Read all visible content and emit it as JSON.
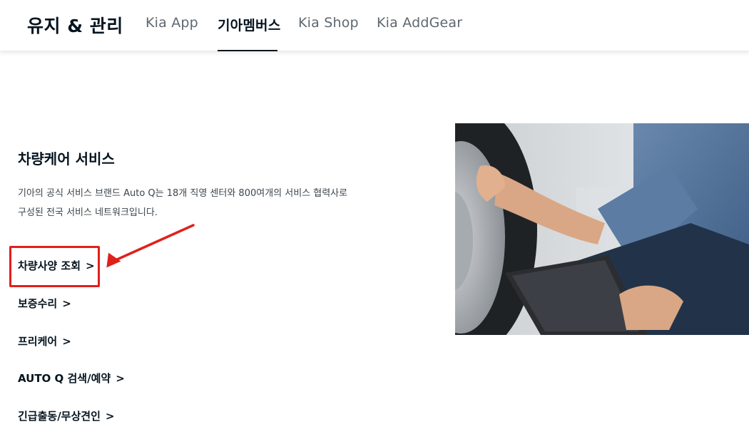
{
  "header": {
    "section_title": "유지 & 관리",
    "tabs": [
      {
        "label": "Kia App",
        "active": false
      },
      {
        "label": "기아멤버스",
        "active": true
      },
      {
        "label": "Kia Shop",
        "active": false
      },
      {
        "label": "Kia AddGear",
        "active": false
      }
    ]
  },
  "main": {
    "title": "차량케어 서비스",
    "description_lines": [
      "기아의 공식 서비스 브랜드 Auto Q는 18개 직영 센터와 800여개의 서비스 협력사로",
      "구성된 전국 서비스 네트워크입니다."
    ],
    "links": [
      {
        "label": "차량사양 조회",
        "highlighted": true
      },
      {
        "label": "보증수리",
        "highlighted": false
      },
      {
        "label": "프리케어",
        "highlighted": false
      },
      {
        "label": "AUTO Q 검색/예약",
        "highlighted": false
      },
      {
        "label": "긴급출동/무상견인",
        "highlighted": false
      }
    ],
    "chevron": ">"
  },
  "colors": {
    "text_primary": "#05141f",
    "text_secondary": "#5e6770",
    "annotation_red": "#e0201a"
  },
  "icons": {
    "link_chevron": "chevron-right-icon"
  }
}
